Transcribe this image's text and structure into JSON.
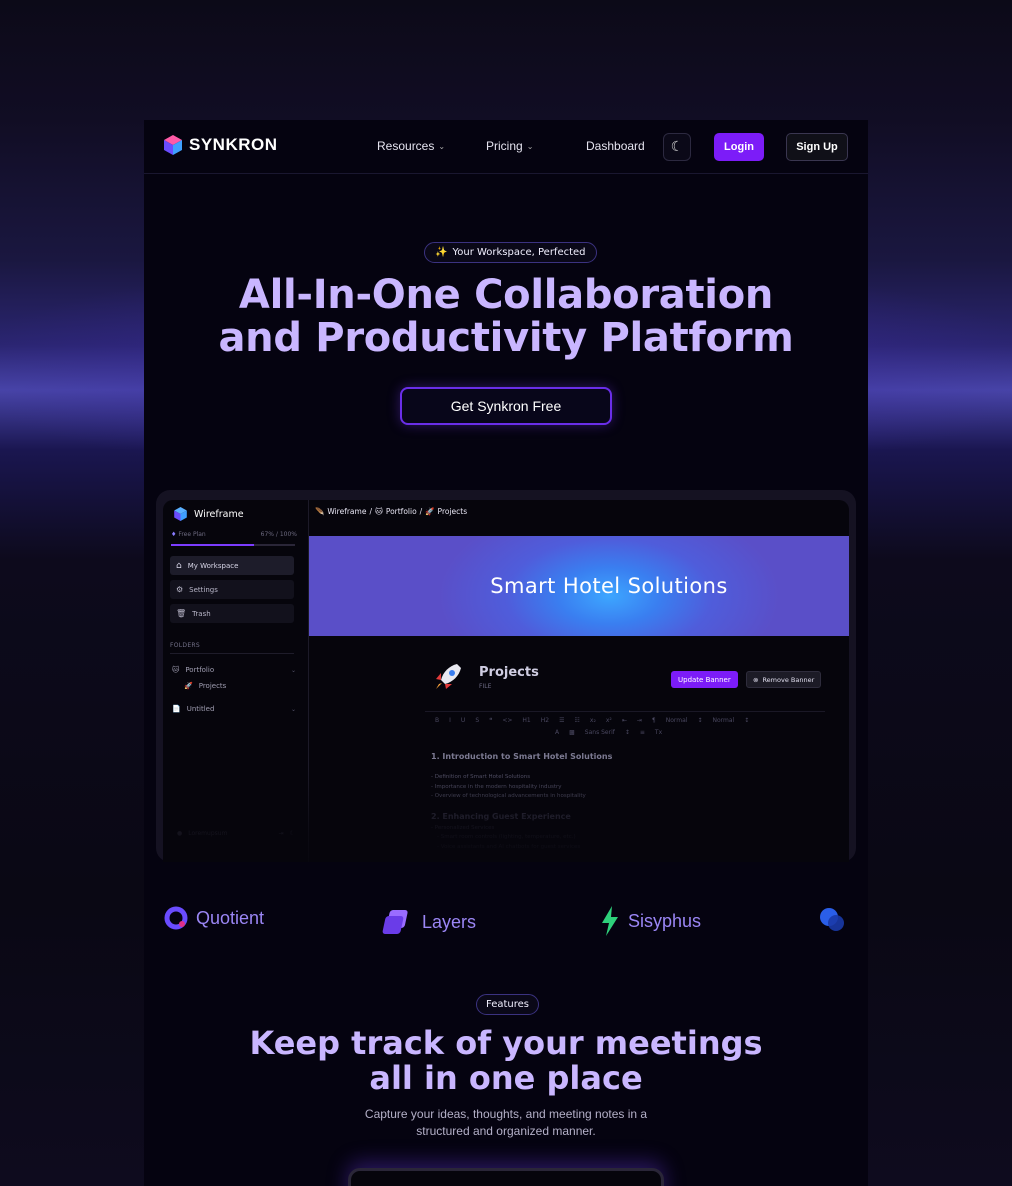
{
  "nav": {
    "brand": "SYNKRON",
    "links": [
      {
        "label": "Resources",
        "has_dropdown": true
      },
      {
        "label": "Pricing",
        "has_dropdown": true
      },
      {
        "label": "Dashboard",
        "has_dropdown": false
      }
    ],
    "theme_icon": "moon-icon",
    "login_label": "Login",
    "signup_label": "Sign Up",
    "accent_color": "#7c1cf8"
  },
  "hero": {
    "pill_icon": "✨",
    "pill_text": "Your Workspace, Perfected",
    "title_line1": "All-In-One Collaboration",
    "title_line2": "and Productivity Platform",
    "cta_label": "Get Synkron Free",
    "title_color": "#c9b6ff"
  },
  "app_preview": {
    "workspace_name": "Wireframe",
    "plan_label": "Free Plan",
    "plan_usage": "67% / 100%",
    "plan_usage_fraction": 0.67,
    "sidebar_items": [
      {
        "label": "My Workspace",
        "icon": "home-icon"
      },
      {
        "label": "Settings",
        "icon": "gear-icon"
      },
      {
        "label": "Trash",
        "icon": "trash-icon"
      }
    ],
    "folders_label": "FOLDERS",
    "folders": [
      {
        "icon": "🐱",
        "label": "Portfolio",
        "children": [
          {
            "icon": "🚀",
            "label": "Projects"
          }
        ]
      },
      {
        "icon": "📄",
        "label": "Untitled",
        "children": []
      }
    ],
    "footer_label": "Loremupsum",
    "breadcrumbs": [
      {
        "icon": "🪶",
        "label": "Wireframe"
      },
      {
        "icon": "🐱",
        "label": "Portfolio"
      },
      {
        "icon": "🚀",
        "label": "Projects"
      }
    ],
    "banner_title": "Smart Hotel Solutions",
    "doc_title": "Projects",
    "doc_subtitle": "FILE",
    "update_banner_label": "Update Banner",
    "remove_banner_label": "Remove Banner",
    "toolbar_row1": [
      "B",
      "I",
      "U",
      "S",
      "❝",
      "<>",
      "H1",
      "H2",
      "☰",
      "☷",
      "x₂",
      "x²",
      "⇤",
      "⇥",
      "¶",
      "Normal",
      "↕",
      "Normal",
      "↕"
    ],
    "toolbar_row2": [
      "A",
      "▩",
      "Sans Serif",
      "↕",
      "≡",
      "Tx"
    ],
    "section1_title": "1. Introduction to Smart Hotel Solutions",
    "section1_bullets": [
      "- Definition of Smart Hotel Solutions",
      "- Importance in the modern hospitality industry",
      "- Overview of technological advancements in hospitality"
    ],
    "section2_title": "2. Enhancing Guest Experience",
    "section2_bullets": [
      "- Personalized Services",
      "  - Smart room controls (lighting, temperature, etc.)",
      "  - Voice assistants and AI chatbots for guest services"
    ]
  },
  "partners": [
    {
      "name": "Quotient",
      "icon": "quotient-logo-icon"
    },
    {
      "name": "Layers",
      "icon": "layers-logo-icon"
    },
    {
      "name": "Sisyphus",
      "icon": "sisyphus-logo-icon"
    },
    {
      "name": "",
      "icon": "circles-logo-icon"
    }
  ],
  "features": {
    "pill_text": "Features",
    "title_line1": "Keep track of your meetings",
    "title_line2": "all in one place",
    "desc_line1": "Capture your ideas, thoughts, and meeting notes in a",
    "desc_line2": "structured and organized manner."
  }
}
